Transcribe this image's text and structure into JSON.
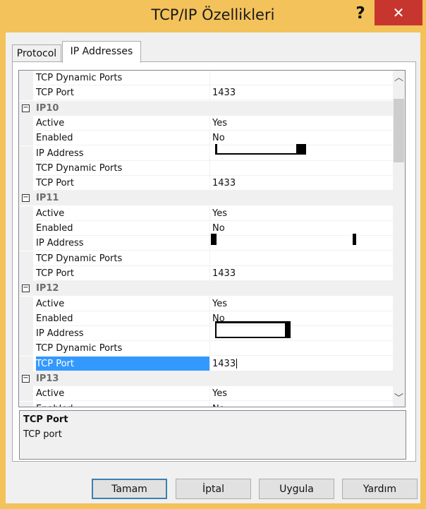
{
  "window": {
    "title": "TCP/IP Özellikleri",
    "help_label": "?",
    "close_label": "✕"
  },
  "tabs": [
    {
      "label": "Protocol"
    },
    {
      "label": "IP Addresses"
    }
  ],
  "grid": {
    "rows": [
      {
        "type": "prop",
        "name": "TCP Dynamic Ports",
        "value": ""
      },
      {
        "type": "prop",
        "name": "TCP Port",
        "value": "1433"
      },
      {
        "type": "cat",
        "name": "IP10"
      },
      {
        "type": "prop",
        "name": "Active",
        "value": "Yes"
      },
      {
        "type": "prop",
        "name": "Enabled",
        "value": "No"
      },
      {
        "type": "prop",
        "name": "IP Address",
        "value": ""
      },
      {
        "type": "prop",
        "name": "TCP Dynamic Ports",
        "value": ""
      },
      {
        "type": "prop",
        "name": "TCP Port",
        "value": "1433"
      },
      {
        "type": "cat",
        "name": "IP11"
      },
      {
        "type": "prop",
        "name": "Active",
        "value": "Yes"
      },
      {
        "type": "prop",
        "name": "Enabled",
        "value": "No"
      },
      {
        "type": "prop",
        "name": "IP Address",
        "value": ""
      },
      {
        "type": "prop",
        "name": "TCP Dynamic Ports",
        "value": ""
      },
      {
        "type": "prop",
        "name": "TCP Port",
        "value": "1433"
      },
      {
        "type": "cat",
        "name": "IP12"
      },
      {
        "type": "prop",
        "name": "Active",
        "value": "Yes"
      },
      {
        "type": "prop",
        "name": "Enabled",
        "value": "No"
      },
      {
        "type": "prop",
        "name": "IP Address",
        "value": ""
      },
      {
        "type": "prop",
        "name": "TCP Dynamic Ports",
        "value": ""
      },
      {
        "type": "prop",
        "name": "TCP Port",
        "value": "1433",
        "selected": true
      },
      {
        "type": "cat",
        "name": "IP13"
      },
      {
        "type": "prop",
        "name": "Active",
        "value": "Yes"
      },
      {
        "type": "prop",
        "name": "Enabled",
        "value": "No"
      }
    ],
    "collapse_glyph": "−"
  },
  "scrollbar": {
    "up_glyph": "︿",
    "down_glyph": "﹀"
  },
  "description": {
    "title": "TCP Port",
    "text": "TCP port"
  },
  "buttons": {
    "ok": "Tamam",
    "cancel": "İptal",
    "apply": "Uygula",
    "help": "Yardım"
  }
}
